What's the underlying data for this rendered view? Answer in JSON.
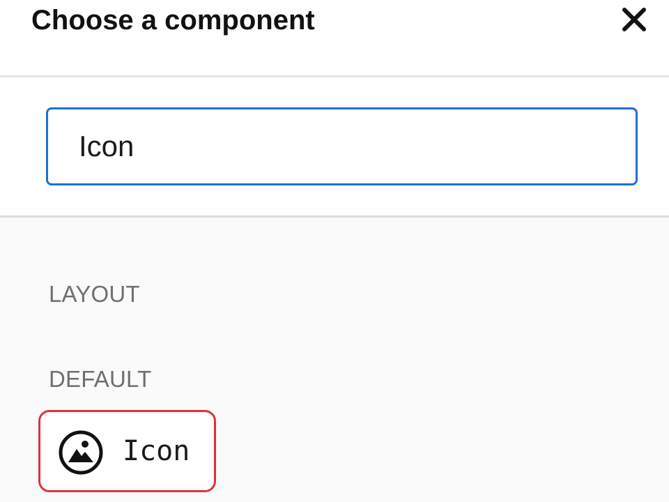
{
  "dialog": {
    "title": "Choose a component",
    "close_icon": "close-icon"
  },
  "search": {
    "value": "Icon",
    "placeholder": ""
  },
  "groups": [
    {
      "label": "LAYOUT",
      "items": []
    },
    {
      "label": "DEFAULT",
      "items": [
        {
          "label": "Icon",
          "icon": "image-icon",
          "highlighted": true
        }
      ]
    }
  ],
  "colors": {
    "focus_border": "#1f6fd1",
    "highlight_border": "#e0303c",
    "group_label": "#6f6f6f"
  }
}
